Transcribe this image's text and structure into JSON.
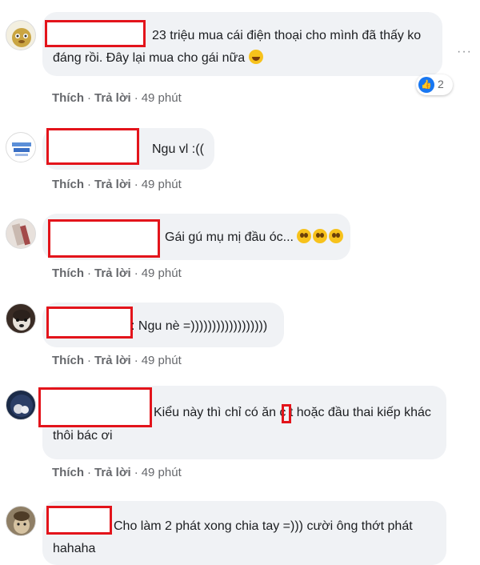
{
  "colors": {
    "bubble": "#f0f2f5",
    "redact": "#e3141b",
    "meta": "#65676b",
    "like": "#1877f2"
  },
  "actions": {
    "like": "Thích",
    "reply": "Trả lời",
    "separator": "·"
  },
  "comments": [
    {
      "lines": [
        "23 triệu mua cái điện thoại cho mình đã thấy ko",
        "đáng rồi. Đây lại mua cho gái nữa"
      ],
      "emoji": "laugh-icon",
      "time": "49 phút",
      "reaction_count": "2"
    },
    {
      "lines": [
        "Ngu vl :(("
      ],
      "time": "49 phút"
    },
    {
      "lines": [
        "Gái gú mụ mị đầu óc..."
      ],
      "emoji": "cry-icon",
      "time": "49 phút"
    },
    {
      "lines": [
        ": Ngu nè =))))))))))))))))))"
      ],
      "time": "49 phút"
    },
    {
      "lines": [
        "Kiểu này thì chỉ có ăn c t hoặc đầu thai kiếp khác",
        "thôi bác ơi"
      ],
      "time": "49 phút"
    },
    {
      "lines": [
        "Cho làm 2 phát xong chia tay =))) cười ông thớt phát",
        "hahaha"
      ]
    }
  ]
}
